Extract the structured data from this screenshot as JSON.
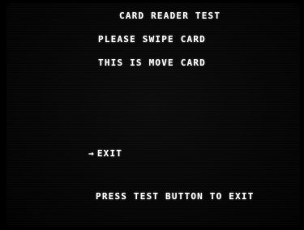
{
  "screen": {
    "title": "CARD READER TEST",
    "instruction": "PLEASE SWIPE CARD",
    "card_status": "THIS IS MOVE CARD",
    "menu": {
      "cursor": "→",
      "items": [
        {
          "label": "EXIT",
          "selected": true
        }
      ]
    },
    "footer": "PRESS TEST BUTTON TO EXIT"
  }
}
